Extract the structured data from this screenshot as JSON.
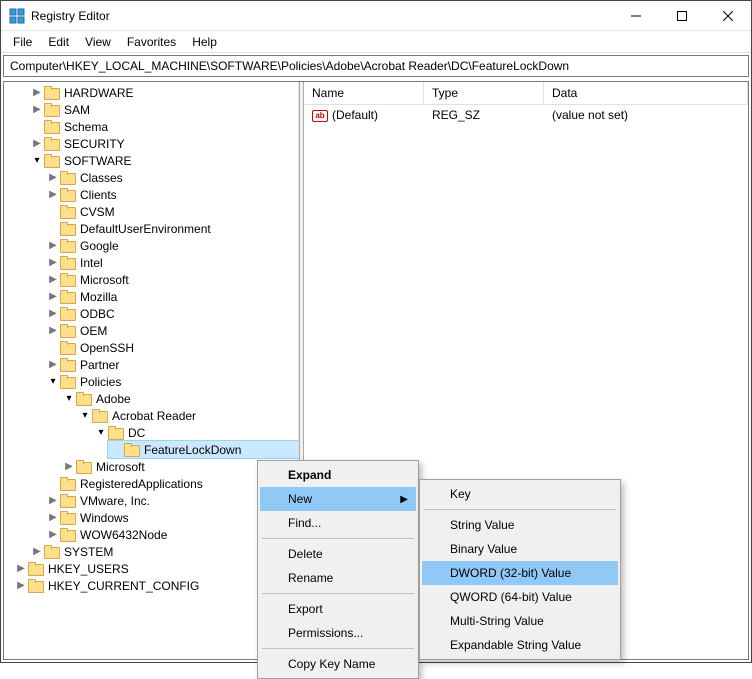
{
  "window": {
    "title": "Registry Editor"
  },
  "menubar": [
    "File",
    "Edit",
    "View",
    "Favorites",
    "Help"
  ],
  "address": "Computer\\HKEY_LOCAL_MACHINE\\SOFTWARE\\Policies\\Adobe\\Acrobat Reader\\DC\\FeatureLockDown",
  "columns": {
    "name": "Name",
    "type": "Type",
    "data": "Data"
  },
  "values": [
    {
      "name": "(Default)",
      "type": "REG_SZ",
      "data": "(value not set)"
    }
  ],
  "tree": {
    "hardware": "HARDWARE",
    "sam": "SAM",
    "schema": "Schema",
    "security": "SECURITY",
    "software": "SOFTWARE",
    "sw": {
      "classes": "Classes",
      "clients": "Clients",
      "cvsm": "CVSM",
      "due": "DefaultUserEnvironment",
      "google": "Google",
      "intel": "Intel",
      "microsoft": "Microsoft",
      "mozilla": "Mozilla",
      "odbc": "ODBC",
      "oem": "OEM",
      "openssh": "OpenSSH",
      "partner": "Partner",
      "policies": "Policies",
      "pol": {
        "adobe": "Adobe",
        "acrobat": "Acrobat Reader",
        "dc": "DC",
        "fld": "FeatureLockDown",
        "ms": "Microsoft"
      },
      "regapps": "RegisteredApplications",
      "vmware": "VMware, Inc.",
      "windows": "Windows",
      "wow": "WOW6432Node"
    },
    "system": "SYSTEM",
    "hku": "HKEY_USERS",
    "hkcc": "HKEY_CURRENT_CONFIG"
  },
  "ctx": {
    "expand": "Expand",
    "new": "New",
    "find": "Find...",
    "delete": "Delete",
    "rename": "Rename",
    "export": "Export",
    "permissions": "Permissions...",
    "copykey": "Copy Key Name"
  },
  "submenu": {
    "key": "Key",
    "string": "String Value",
    "binary": "Binary Value",
    "dword": "DWORD (32-bit) Value",
    "qword": "QWORD (64-bit) Value",
    "multi": "Multi-String Value",
    "expand": "Expandable String Value"
  }
}
